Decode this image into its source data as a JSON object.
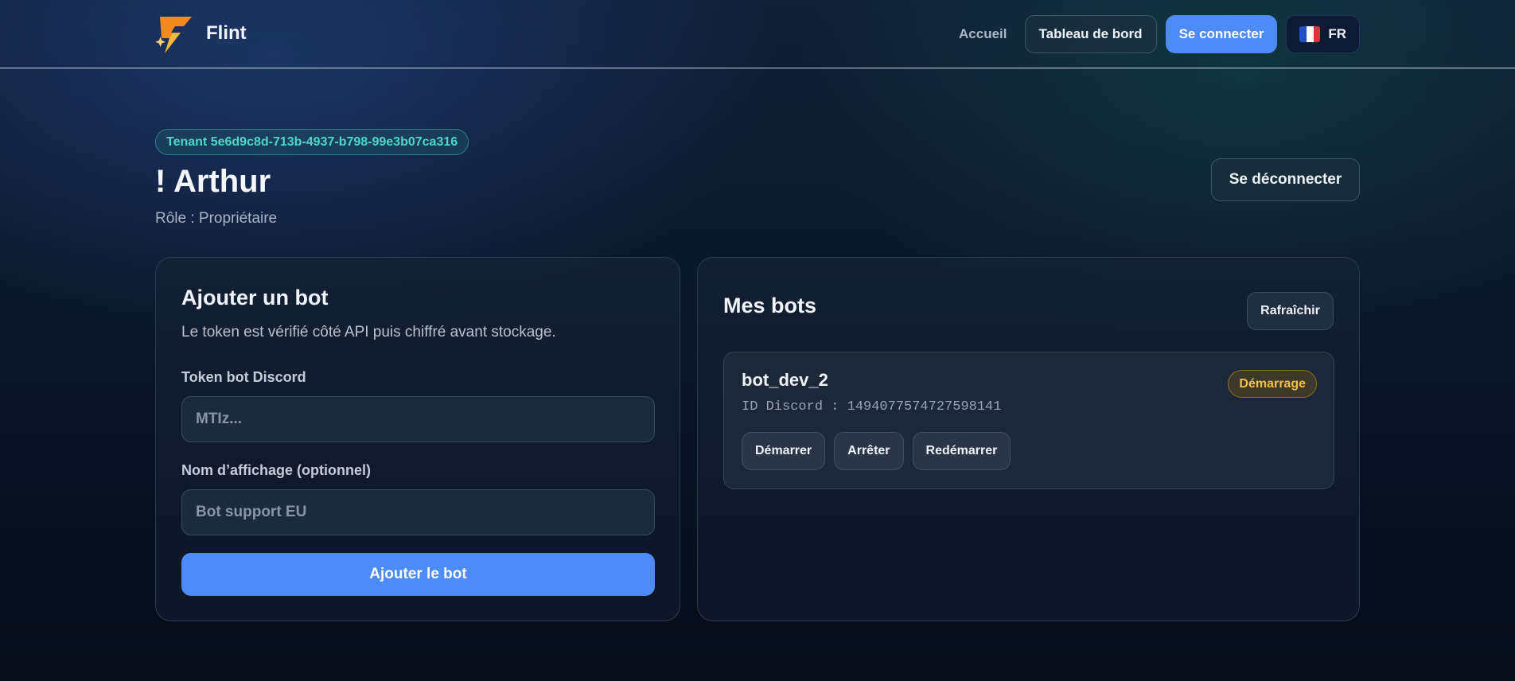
{
  "header": {
    "brand": "Flint",
    "nav": {
      "home": "Accueil",
      "dashboard": "Tableau de bord",
      "login": "Se connecter",
      "lang": "FR"
    }
  },
  "hero": {
    "tenant": "Tenant 5e6d9c8d-713b-4937-b798-99e3b07ca316",
    "greeting": "! Arthur",
    "role": "Rôle : Propriétaire",
    "logout": "Se déconnecter"
  },
  "add_bot": {
    "title": "Ajouter un bot",
    "subtitle": "Le token est vérifié côté API puis chiffré avant stockage.",
    "token_label": "Token bot Discord",
    "token_placeholder": "MTIz...",
    "name_label": "Nom d’affichage (optionnel)",
    "name_placeholder": "Bot support EU",
    "submit": "Ajouter le bot"
  },
  "my_bots": {
    "title": "Mes bots",
    "refresh": "Rafraîchir",
    "bots": [
      {
        "name": "bot_dev_2",
        "discord_id": "ID Discord : 1494077574727598141",
        "status": "Démarrage",
        "actions": [
          "Démarrer",
          "Arrêter",
          "Redémarrer"
        ]
      }
    ]
  },
  "colors": {
    "accent": "#4d8cf7",
    "tenant_badge": "#4fd6c6",
    "status_starting": "#f2c14a"
  }
}
